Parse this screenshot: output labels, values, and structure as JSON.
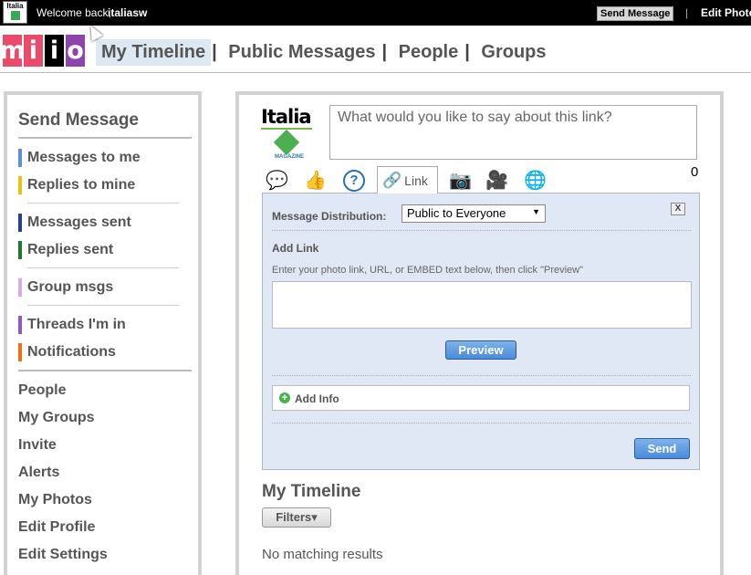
{
  "topbar": {
    "mini_logo": "Italia",
    "welcome": "Welcome back,",
    "username": "italiasw",
    "send_message": "Send Message",
    "separator": "|",
    "edit_photo": "Edit Photo"
  },
  "logo": {
    "letters": [
      "m",
      "i",
      "i",
      "o"
    ],
    "colors": [
      "#e84c6a",
      "#e84c6a",
      "#000000",
      "#8e44ad"
    ]
  },
  "nav": {
    "tabs": [
      "My Timeline",
      "Public Messages",
      "People",
      "Groups"
    ],
    "active": "My Timeline",
    "active_bg": "#dde8f3",
    "pipe": "|"
  },
  "sidebar": {
    "title": "Send Message",
    "items": [
      {
        "label": "Messages to me",
        "color": "#5b8fd6"
      },
      {
        "label": "Replies to mine",
        "color": "#e8c21a"
      },
      {
        "label": "Messages sent",
        "color": "#2c3e8f"
      },
      {
        "label": "Replies sent",
        "color": "#1e7a2a"
      },
      {
        "label": "Group msgs",
        "color": "#d8a8e8"
      },
      {
        "label": "Threads I'm in",
        "color": "#8e5bb8"
      },
      {
        "label": "Notifications",
        "color": "#f06d1a"
      }
    ],
    "links": [
      "People",
      "My Groups",
      "Invite",
      "Alerts",
      "My Photos",
      "Edit Profile",
      "Edit Settings"
    ]
  },
  "composer": {
    "avatar_brand": "Italia",
    "avatar_sub": "MAGAZINE",
    "placeholder": "What would you like to say about this link?",
    "counter": "0",
    "tabs": [
      {
        "icon": "speech-bubble-icon",
        "glyph": "💬"
      },
      {
        "icon": "thumbs-up-icon",
        "glyph": "👍"
      },
      {
        "icon": "question-icon",
        "glyph": "?"
      },
      {
        "icon": "camera-icon",
        "glyph": "📷"
      },
      {
        "icon": "video-camera-icon",
        "glyph": "🎥"
      },
      {
        "icon": "globe-icon",
        "glyph": "🌐"
      }
    ],
    "active_tab": {
      "icon": "link-icon",
      "glyph": "🔗",
      "label": "Link"
    }
  },
  "panel": {
    "distribution_label": "Message Distribution:",
    "distribution_value": "Public to Everyone",
    "close": "X",
    "add_link": "Add Link",
    "hint": "Enter your photo link, URL, or EMBED text below, then click \"Preview\"",
    "preview": "Preview",
    "add_info": "Add Info",
    "send": "Send"
  },
  "timeline": {
    "title": "My Timeline",
    "filters": "Filters▾",
    "empty": "No matching results"
  }
}
